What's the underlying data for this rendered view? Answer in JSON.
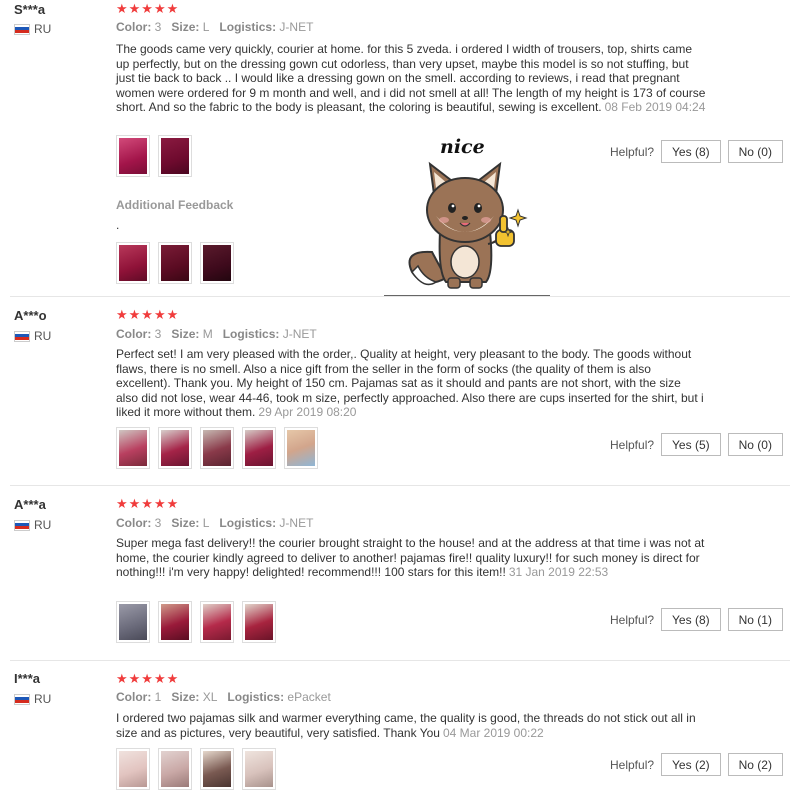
{
  "reviews": [
    {
      "user": "S***a",
      "country": "RU",
      "stars": "★★★★★",
      "color_label": "Color:",
      "color_value": "3",
      "size_label": "Size:",
      "size_value": "L",
      "logistics_label": "Logistics:",
      "logistics_value": "J-NET",
      "text": "The goods came very quickly, courier at home. for this 5 zveda. i ordered I width of trousers, top, shirts came up perfectly, but on the dressing gown cut odorless, than very upset, maybe this model is so not stuffing, but just tie back to back .. I would like a dressing gown on the smell. according to reviews, i read that pregnant women were ordered for 9 m month and well, and i did not smell at all! The length of my height is 173 of course short. And so the fabric to the body is pleasant, the coloring is beautiful, sewing is excellent.",
      "date": "08 Feb 2019 04:24",
      "thumb_colors": [
        "#a3154a",
        "#6e0a2e"
      ],
      "helpful_label": "Helpful?",
      "yes_label": "Yes (8)",
      "no_label": "No (0)",
      "additional_label": "Additional Feedback",
      "additional_text": ".",
      "additional_thumb_colors": [
        "#8f1238",
        "#5a0b22",
        "#3e0a1c"
      ]
    },
    {
      "user": "A***o",
      "country": "RU",
      "stars": "★★★★★",
      "color_label": "Color:",
      "color_value": "3",
      "size_label": "Size:",
      "size_value": "M",
      "logistics_label": "Logistics:",
      "logistics_value": "J-NET",
      "text": "Perfect set! I am very pleased with the order,. Quality at height, very pleasant to the body. The goods without flaws, there is no smell. Also a nice gift from the seller in the form of socks (the quality of them is also excellent). Thank you. My height of 150 cm. Pajamas sat as it should and pants are not short, with the size also did not lose, wear 44-46, took m size, perfectly approached. Also there are cups inserted for the shirt, but i liked it more without them.",
      "date": "29 Apr 2019 08:20",
      "thumb_colors": [
        "#b94060",
        "#a52448",
        "#8a3a4a",
        "#9e1f44",
        "#d2a58c"
      ],
      "helpful_label": "Helpful?",
      "yes_label": "Yes (5)",
      "no_label": "No (0)"
    },
    {
      "user": "A***a",
      "country": "RU",
      "stars": "★★★★★",
      "color_label": "Color:",
      "color_value": "3",
      "size_label": "Size:",
      "size_value": "L",
      "logistics_label": "Logistics:",
      "logistics_value": "J-NET",
      "text": "Super mega fast delivery!! the courier brought straight to the house! and at the address at that time i was not at home, the courier kindly agreed to deliver to another! pajamas fire!! quality luxury!! for such money is direct for nothing!!! i'm very happy! delighted! recommend!!! 100 stars for this item!!",
      "date": "31 Jan 2019 22:53",
      "thumb_colors": [
        "#6a6a7a",
        "#9a1a3a",
        "#b52a4a",
        "#a8243f"
      ],
      "helpful_label": "Helpful?",
      "yes_label": "Yes (8)",
      "no_label": "No (1)"
    },
    {
      "user": "I***a",
      "country": "RU",
      "stars": "★★★★★",
      "color_label": "Color:",
      "color_value": "1",
      "size_label": "Size:",
      "size_value": "XL",
      "logistics_label": "Logistics:",
      "logistics_value": "ePacket",
      "text": "I ordered two pajamas silk and warmer everything came, the quality is good, the threads do not stick out all in size and as pictures, very beautiful, very satisfied. Thank You",
      "date": "04 Mar 2019 00:22",
      "thumb_colors": [
        "#e2c4c0",
        "#c9a8a6",
        "#7a5a52",
        "#d8c2bc"
      ],
      "helpful_label": "Helpful?",
      "yes_label": "Yes (2)",
      "no_label": "No (2)"
    }
  ],
  "sticker": {
    "text": "nice",
    "icon": "fox-thumbs-up-icon",
    "fur_color": "#9b7356",
    "glove_color": "#f2c230"
  }
}
